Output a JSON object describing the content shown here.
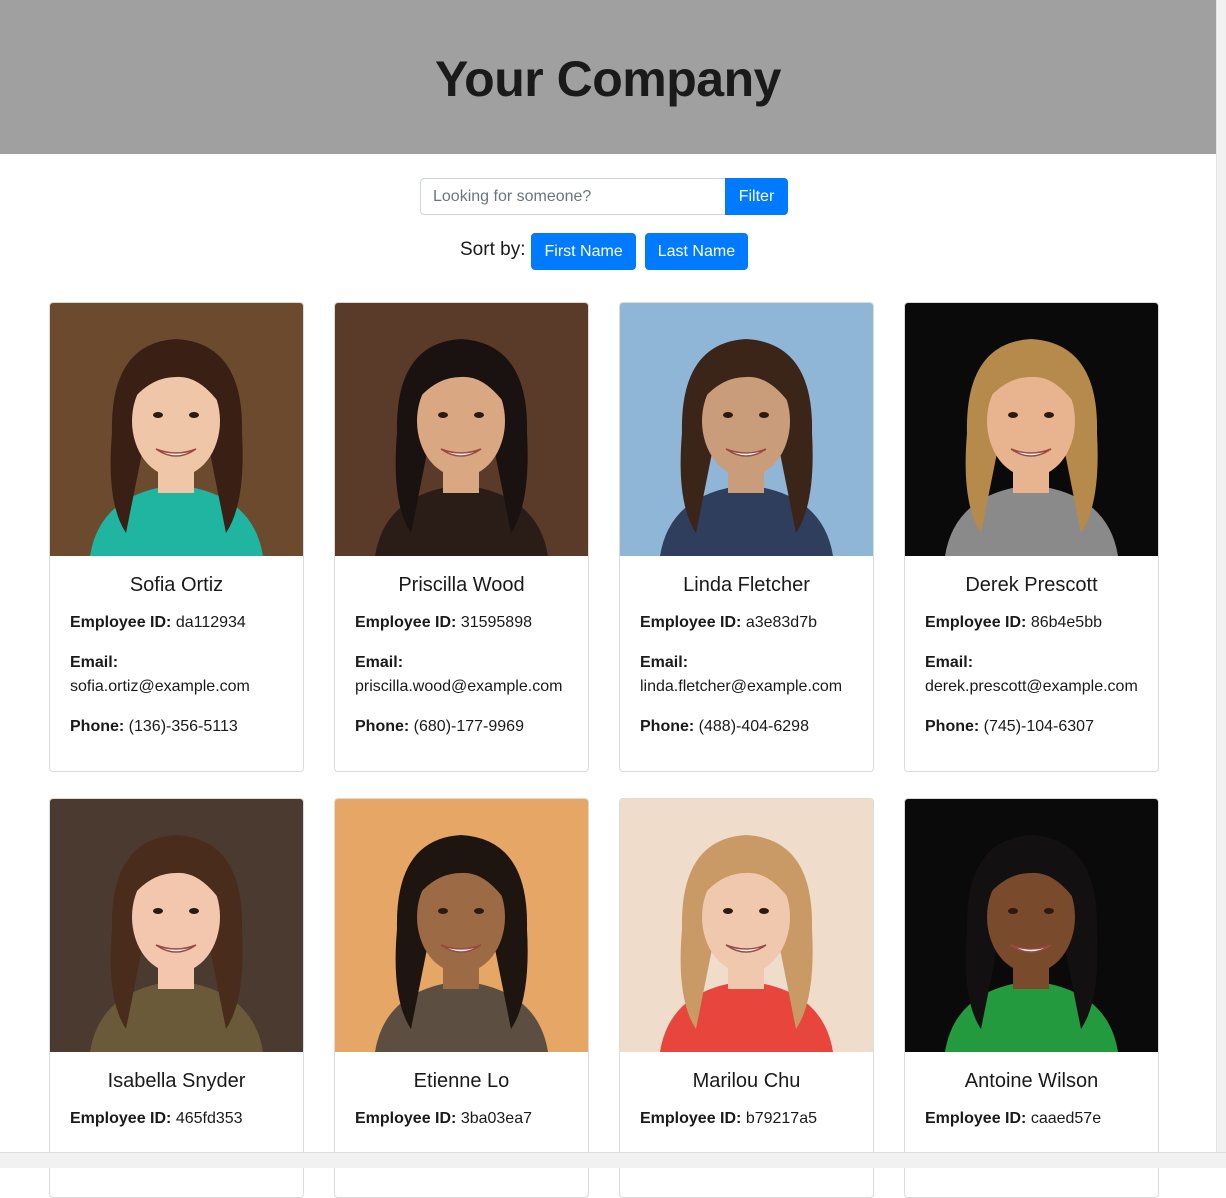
{
  "header": {
    "title": "Your Company"
  },
  "search": {
    "placeholder": "Looking for someone?",
    "value": "",
    "filter_label": "Filter"
  },
  "sort": {
    "label": "Sort by:",
    "first_name_label": "First Name",
    "last_name_label": "Last Name"
  },
  "field_labels": {
    "id": "Employee ID:",
    "email": "Email:",
    "phone": "Phone:"
  },
  "employees": [
    {
      "name": "Sofia Ortiz",
      "id": "da112934",
      "email": "sofia.ortiz@example.com",
      "phone": "(136)-356-5113",
      "photo": "portrait-photo",
      "colors": {
        "bg": "#6b4a2e",
        "skin": "#f0c6a8",
        "hair": "#3a1f14",
        "shirt": "#1fb5a0"
      }
    },
    {
      "name": "Priscilla Wood",
      "id": "31595898",
      "email": "priscilla.wood@example.com",
      "phone": "(680)-177-9969",
      "photo": "portrait-photo",
      "colors": {
        "bg": "#5a3b2a",
        "skin": "#d9a882",
        "hair": "#1a1210",
        "shirt": "#2a1c16"
      }
    },
    {
      "name": "Linda Fletcher",
      "id": "a3e83d7b",
      "email": "linda.fletcher@example.com",
      "phone": "(488)-404-6298",
      "photo": "portrait-photo",
      "colors": {
        "bg": "#8fb6d6",
        "skin": "#c99d7a",
        "hair": "#3b2418",
        "shirt": "#2e3e5c"
      }
    },
    {
      "name": "Derek Prescott",
      "id": "86b4e5bb",
      "email": "derek.prescott@example.com",
      "phone": "(745)-104-6307",
      "photo": "portrait-photo",
      "colors": {
        "bg": "#0a0a0a",
        "skin": "#e8b48f",
        "hair": "#b58a4a",
        "shirt": "#8a8a8a"
      }
    },
    {
      "name": "Isabella Snyder",
      "id": "465fd353",
      "photo": "portrait-photo",
      "colors": {
        "bg": "#4a3a30",
        "skin": "#f2c7ad",
        "hair": "#4a2c1c",
        "shirt": "#6b5a3a"
      }
    },
    {
      "name": "Etienne Lo",
      "id": "3ba03ea7",
      "photo": "portrait-photo",
      "colors": {
        "bg": "#e6a766",
        "skin": "#9c6a44",
        "hair": "#1e1410",
        "shirt": "#5c4e40"
      }
    },
    {
      "name": "Marilou Chu",
      "id": "b79217a5",
      "photo": "portrait-photo",
      "colors": {
        "bg": "#efdccb",
        "skin": "#f0c8ae",
        "hair": "#c99a66",
        "shirt": "#e8453c"
      }
    },
    {
      "name": "Antoine Wilson",
      "id": "caaed57e",
      "photo": "portrait-photo",
      "colors": {
        "bg": "#0a0a0a",
        "skin": "#7a4a2c",
        "hair": "#121010",
        "shirt": "#239a3e"
      }
    }
  ]
}
